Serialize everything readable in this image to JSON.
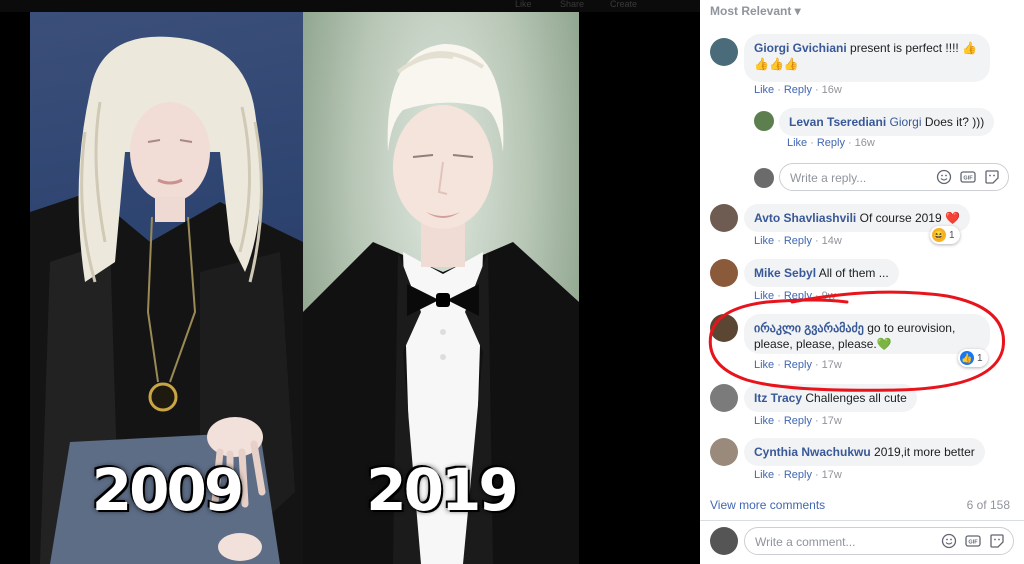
{
  "viewer": {
    "topbar_items": [
      "Like",
      "Share",
      "Create"
    ],
    "left_year": "2009",
    "right_year": "2019"
  },
  "comments": {
    "sort_label": "Most Relevant ▾",
    "items": [
      {
        "author": "Giorgi Gvichiani",
        "text": "present is perfect !!!! 👍 👍👍👍",
        "like": "Like",
        "reply": "Reply",
        "time": "16w"
      },
      {
        "author": "Levan Tserediani",
        "mention": "Giorgi",
        "text": "Does it? )))",
        "like": "Like",
        "reply": "Reply",
        "time": "16w"
      },
      {
        "author": "Avto Shavliashvili",
        "text": "Of course 2019 ❤️",
        "like": "Like",
        "reply": "Reply",
        "time": "14w",
        "reaction_count": "1"
      },
      {
        "author": "Mike Sebyl",
        "text": "All of them ...",
        "like": "Like",
        "reply": "Reply",
        "time": "9w"
      },
      {
        "author": "ირაკლი გვარამაძე",
        "text": "go to eurovision, please, please, please.💚",
        "like": "Like",
        "reply": "Reply",
        "time": "17w",
        "reaction_count": "1"
      },
      {
        "author": "Itz Tracy",
        "text": "Challenges all cute",
        "like": "Like",
        "reply": "Reply",
        "time": "17w"
      },
      {
        "author": "Cynthia Nwachukwu",
        "text": "2019,it more better",
        "like": "Like",
        "reply": "Reply",
        "time": "17w"
      }
    ],
    "reply_placeholder": "Write a reply...",
    "comment_placeholder": "Write a comment...",
    "view_more": "View more comments",
    "count": "6 of 158",
    "icons": [
      "emoji-icon",
      "gif-icon",
      "sticker-icon"
    ]
  }
}
